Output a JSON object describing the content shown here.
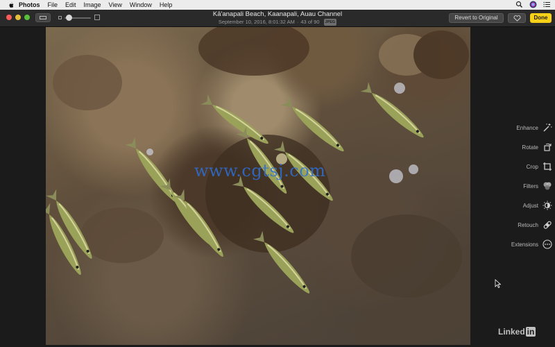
{
  "menubar": {
    "app_name": "Photos",
    "items": [
      "File",
      "Edit",
      "Image",
      "View",
      "Window",
      "Help"
    ],
    "icons": [
      "search-icon",
      "siri-icon",
      "list-icon"
    ]
  },
  "toolbar": {
    "photo_title": "Kā'anapali Beach, Kaanapali, Auau Channel",
    "photo_date": "September 10, 2016, 8:01:32 AM",
    "photo_position": "43 of 90",
    "format_badge": "JPEG",
    "revert_label": "Revert to Original",
    "favorite_icon": "heart-icon",
    "done_label": "Done",
    "zoom_level": 0.1
  },
  "photo": {
    "watermark": "www.cgtsj.com",
    "corner_logo": "Linked",
    "corner_logo_in": "in"
  },
  "tools": [
    {
      "label": "Enhance",
      "icon": "magic-wand-icon"
    },
    {
      "label": "Rotate",
      "icon": "rotate-icon"
    },
    {
      "label": "Crop",
      "icon": "crop-icon"
    },
    {
      "label": "Filters",
      "icon": "filters-icon"
    },
    {
      "label": "Adjust",
      "icon": "adjust-icon"
    },
    {
      "label": "Retouch",
      "icon": "bandage-icon"
    },
    {
      "label": "Extensions",
      "icon": "more-icon"
    }
  ],
  "colors": {
    "accent_done": "#f7d117",
    "close": "#fc5b57",
    "minimize": "#e5bf3c",
    "maximize": "#57c038"
  }
}
